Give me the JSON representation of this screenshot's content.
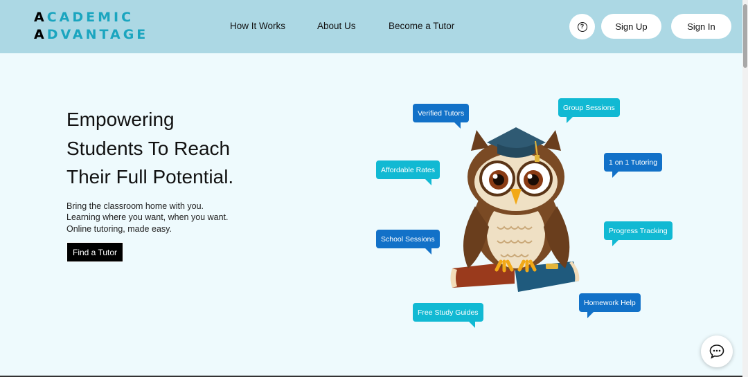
{
  "header": {
    "logo_line1_first": "A",
    "logo_line1_rest": "CADEMIC",
    "logo_line2_first": "A",
    "logo_line2_rest": "DVANTAGE",
    "nav": [
      "How It Works",
      "About Us",
      "Become a Tutor"
    ],
    "help_icon": "question-icon",
    "sign_up": "Sign Up",
    "sign_in": "Sign In"
  },
  "hero": {
    "headline": [
      "Empowering",
      "Students To Reach",
      "Their Full Potential."
    ],
    "subtext": [
      "Bring the classroom home with you.",
      "Learning where you want, when you want.",
      "Online tutoring, made easy."
    ],
    "cta": "Find a Tutor"
  },
  "bubbles": {
    "verified_tutors": "Verified Tutors",
    "group_sessions": "Group Sessions",
    "affordable_rates": "Affordable Rates",
    "one_on_one": "1 on 1 Tutoring",
    "school_sessions": "School Sessions",
    "progress_tracking": "Progress Tracking",
    "free_study_guides": "Free Study Guides",
    "homework_help": "Homework Help"
  },
  "colors": {
    "header_bg": "#acd8e4",
    "page_bg": "#eefafd",
    "logo_accent": "#1aa5bf",
    "bubble_blue": "#1271c8",
    "bubble_cyan": "#11b9d3"
  },
  "chat": {
    "icon": "chat-bubble-icon"
  }
}
